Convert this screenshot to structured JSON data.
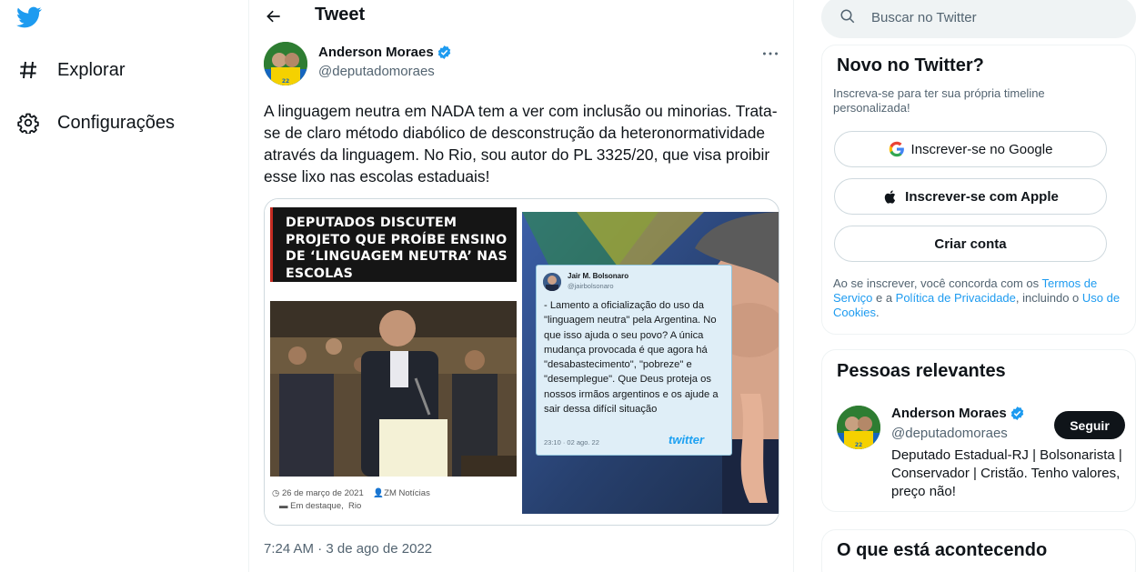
{
  "nav": {
    "explore_label": "Explorar",
    "settings_label": "Configurações"
  },
  "header": {
    "title": "Tweet"
  },
  "tweet": {
    "author_name": "Anderson Moraes",
    "author_handle": "@deputadomoraes",
    "text": "A linguagem neutra em NADA tem a ver com inclusão ou minorias. Trata-se de claro método diabólico de desconstrução da heteronormatividade através da linguagem. No Rio, sou autor do PL 3325/20, que visa proibir esse lixo nas escolas estaduais!",
    "timestamp": "7:24 AM · 3 de ago de 2022",
    "media": {
      "headline": "DEPUTADOS DISCUTEM PROJETO QUE PROÍBE ENSINO DE ‘LINGUAGEM NEUTRA’ NAS ESCOLAS",
      "date": "26 de março de 2021",
      "source": "ZM Notícias",
      "categories": "Em destaque,",
      "region": "Rio",
      "embedded_tweet": {
        "name": "Jair M. Bolsonaro",
        "handle": "@jairbolsonaro",
        "text": "- Lamento a oficialização do uso da \"linguagem neutra\" pela Argentina. No que isso ajuda o seu povo? A única mudança provocada é que agora há \"desabastecimento\", \"pobreze\" e \"desemplegue\". Que Deus proteja os nossos irmãos argentinos e os ajude a sair dessa difícil situação",
        "time": "23:10 · 02 ago. 22",
        "logo_text": "twitter"
      }
    }
  },
  "search": {
    "placeholder": "Buscar no Twitter"
  },
  "signup_card": {
    "title": "Novo no Twitter?",
    "subtitle": "Inscreva-se para ter sua própria timeline personalizada!",
    "google_label": "Inscrever-se no Google",
    "apple_label": "Inscrever-se com Apple",
    "create_label": "Criar conta",
    "terms_prefix": "Ao se inscrever, você concorda com os ",
    "terms_link": "Termos de Serviço",
    "terms_mid": " e a ",
    "privacy_link": "Política de Privacidade",
    "terms_mid2": ", incluindo o ",
    "cookies_link": "Uso de Cookies",
    "terms_suffix": "."
  },
  "people_card": {
    "title": "Pessoas relevantes",
    "name": "Anderson Moraes",
    "handle": "@deputadomoraes",
    "follow_label": "Seguir",
    "bio": "Deputado Estadual-RJ | Bolsonarista | Conservador | Cristão. Tenho valores, preço não!"
  },
  "happening_card": {
    "title": "O que está acontecendo"
  },
  "colors": {
    "twitter_blue": "#1d9bf0",
    "text_primary": "#0f1419",
    "text_secondary": "#536471",
    "border": "#eff3f4"
  }
}
